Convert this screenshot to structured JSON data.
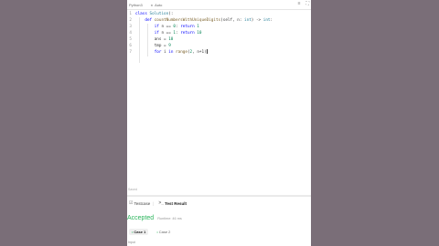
{
  "topbar": {
    "language": "Python3",
    "mode": "Auto"
  },
  "editor": {
    "lines": [
      {
        "num": "1",
        "parts": [
          [
            "kw",
            "class "
          ],
          [
            "ty",
            "Solution"
          ],
          [
            "",
            "(:"
          ]
        ]
      },
      {
        "num": "2",
        "parts": [
          [
            "",
            "    "
          ],
          [
            "kw",
            "def "
          ],
          [
            "fn",
            "countNumbersWithUniqueDigits"
          ],
          [
            "",
            "(self, n: "
          ],
          [
            "ty",
            "int"
          ],
          [
            "",
            ") -> "
          ],
          [
            "ty",
            "int"
          ],
          [
            "",
            ":"
          ]
        ]
      },
      {
        "num": "3",
        "parts": [
          [
            "",
            "        "
          ],
          [
            "kw",
            "if "
          ],
          [
            "",
            "n == "
          ],
          [
            "num",
            "0"
          ],
          [
            "",
            ": "
          ],
          [
            "kw",
            "return "
          ],
          [
            "num",
            "1"
          ]
        ]
      },
      {
        "num": "4",
        "parts": [
          [
            "",
            "        "
          ],
          [
            "kw",
            "if "
          ],
          [
            "",
            "n == "
          ],
          [
            "num",
            "1"
          ],
          [
            "",
            ": "
          ],
          [
            "kw",
            "return "
          ],
          [
            "num",
            "10"
          ]
        ]
      },
      {
        "num": "5",
        "parts": [
          [
            "",
            "        ans = "
          ],
          [
            "num",
            "10"
          ]
        ]
      },
      {
        "num": "6",
        "parts": [
          [
            "",
            "        tmp = "
          ],
          [
            "num",
            "9"
          ]
        ]
      },
      {
        "num": "7",
        "parts": [
          [
            "",
            "        "
          ],
          [
            "kw",
            "for "
          ],
          [
            "",
            "i "
          ],
          [
            "kw",
            "in "
          ],
          [
            "fn",
            "range"
          ],
          [
            "",
            "("
          ],
          [
            "num",
            "2"
          ],
          [
            "",
            ", n+1)"
          ]
        ]
      }
    ],
    "saved_text": "Saved"
  },
  "bottom": {
    "tab_testcase": "Testcase",
    "tab_result": "Test Result",
    "status": "Accepted",
    "runtime": "Runtime: 46 ms",
    "cases": [
      "Case 1",
      "Case 2"
    ],
    "input_label": "Input"
  }
}
